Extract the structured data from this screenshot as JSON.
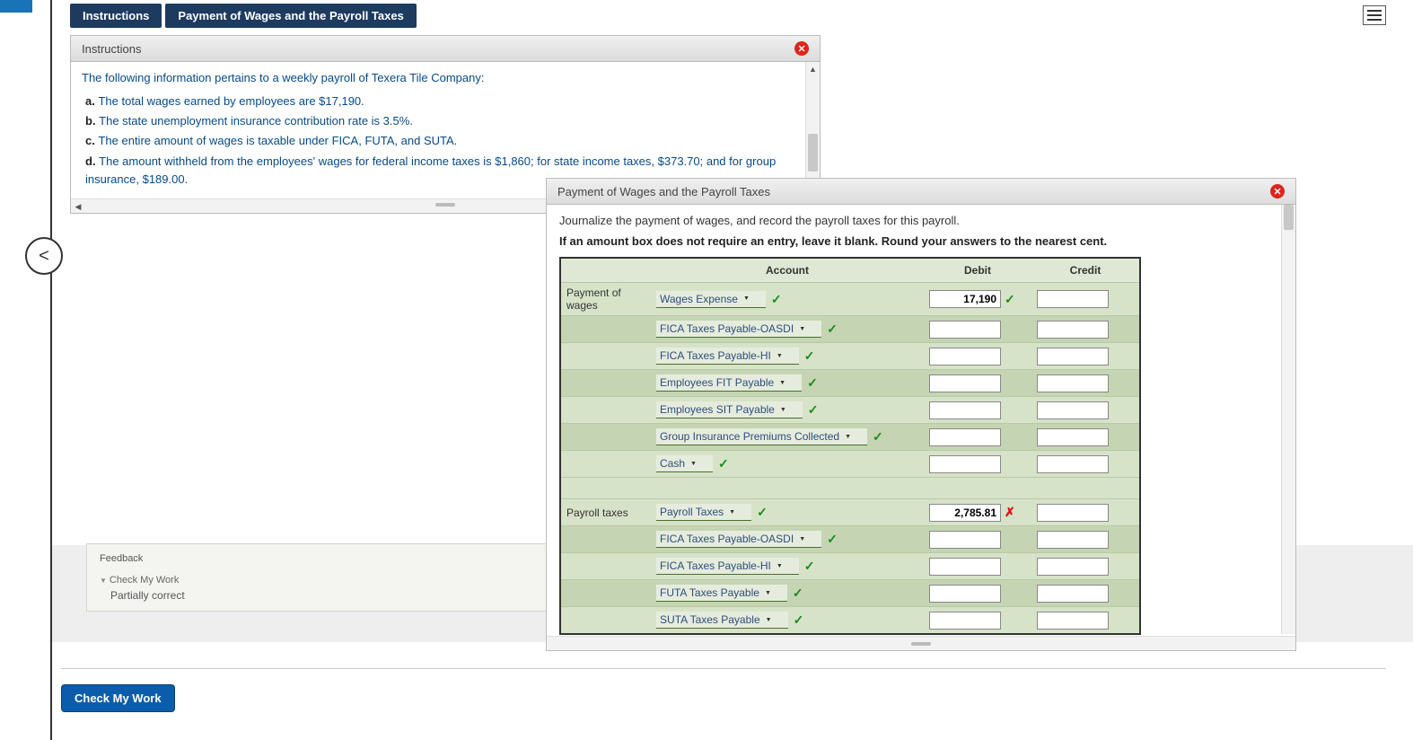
{
  "tabs": {
    "instructions": "Instructions",
    "payment": "Payment of Wages and the Payroll Taxes"
  },
  "instructions_panel": {
    "title": "Instructions",
    "intro": "The following information pertains to a weekly payroll of Texera Tile Company:",
    "items": [
      {
        "label": "a.",
        "text": "The total wages earned by employees are $17,190."
      },
      {
        "label": "b.",
        "text": "The state unemployment insurance contribution rate is 3.5%."
      },
      {
        "label": "c.",
        "text": "The entire amount of wages is taxable under FICA, FUTA, and SUTA."
      },
      {
        "label": "d.",
        "text": "The amount withheld from the employees' wages for federal income taxes is $1,860; for state income taxes, $373.70; and for group insurance, $189.00."
      }
    ]
  },
  "feedback": {
    "title": "Feedback",
    "check_label": "Check My Work",
    "result": "Partially correct"
  },
  "check_button": "Check My Work",
  "ledger_panel": {
    "title": "Payment of Wages and the Payroll Taxes",
    "line1": "Journalize the payment of wages, and record the payroll taxes for this payroll.",
    "line2": "If an amount box does not require an entry, leave it blank. Round your answers to the nearest cent.",
    "headers": {
      "account": "Account",
      "debit": "Debit",
      "credit": "Credit"
    },
    "section1_label": "Payment of wages",
    "section2_label": "Payroll taxes",
    "rows1": [
      {
        "acct": "Wages Expense",
        "debit": "17,190",
        "debit_status": "check"
      },
      {
        "acct": "FICA Taxes Payable-OASDI"
      },
      {
        "acct": "FICA Taxes Payable-HI"
      },
      {
        "acct": "Employees FIT Payable"
      },
      {
        "acct": "Employees SIT Payable"
      },
      {
        "acct": "Group Insurance Premiums Collected"
      },
      {
        "acct": "Cash"
      }
    ],
    "rows2": [
      {
        "acct": "Payroll Taxes",
        "debit": "2,785.81",
        "debit_status": "x"
      },
      {
        "acct": "FICA Taxes Payable-OASDI"
      },
      {
        "acct": "FICA Taxes Payable-HI"
      },
      {
        "acct": "FUTA Taxes Payable"
      },
      {
        "acct": "SUTA Taxes Payable"
      }
    ]
  }
}
